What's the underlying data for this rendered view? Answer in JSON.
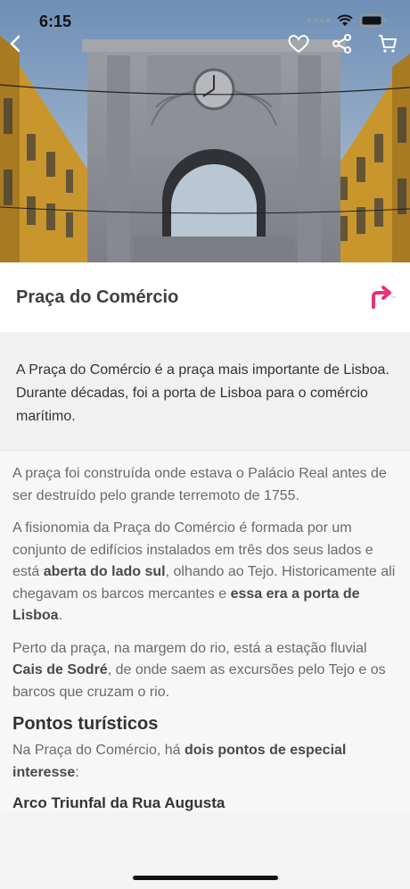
{
  "status_bar": {
    "time": "6:15"
  },
  "icons": {
    "back": "chevron-left-icon",
    "favorite": "heart-icon",
    "share": "share-icon",
    "cart": "cart-icon",
    "route": "route-arrow-icon"
  },
  "colors": {
    "accent": "#e6327a"
  },
  "place": {
    "title": "Praça do Comércio"
  },
  "intro": "A Praça do Comércio é a praça mais importante de Lisboa. Durante décadas, foi a porta de Lisboa para o comércio marítimo.",
  "paragraphs": {
    "p1": "A praça foi construída onde estava o Palácio Real antes de ser destruído pelo grande terremoto de 1755.",
    "p2_a": "A fisionomia da Praça do Comércio é formada por um conjunto de edifícios instalados em três dos seus lados e está ",
    "p2_b": "aberta do lado sul",
    "p2_c": ", olhando ao Tejo. Historicamente ali chegavam os barcos mercantes e ",
    "p2_d": "essa era a porta de Lisboa",
    "p2_e": ".",
    "p3_a": "Perto da praça, na margem do rio, está a estação fluvial ",
    "p3_b": "Cais de Sodré",
    "p3_c": ", de onde saem as excursões pelo Tejo e os barcos que cruzam o rio.",
    "p4_a": "Na Praça do Comércio, há ",
    "p4_b": "dois pontos de especial interesse",
    "p4_c": ":"
  },
  "headings": {
    "tourist_points": "Pontos turísticos",
    "arch": "Arco Triunfal da Rua Augusta"
  }
}
